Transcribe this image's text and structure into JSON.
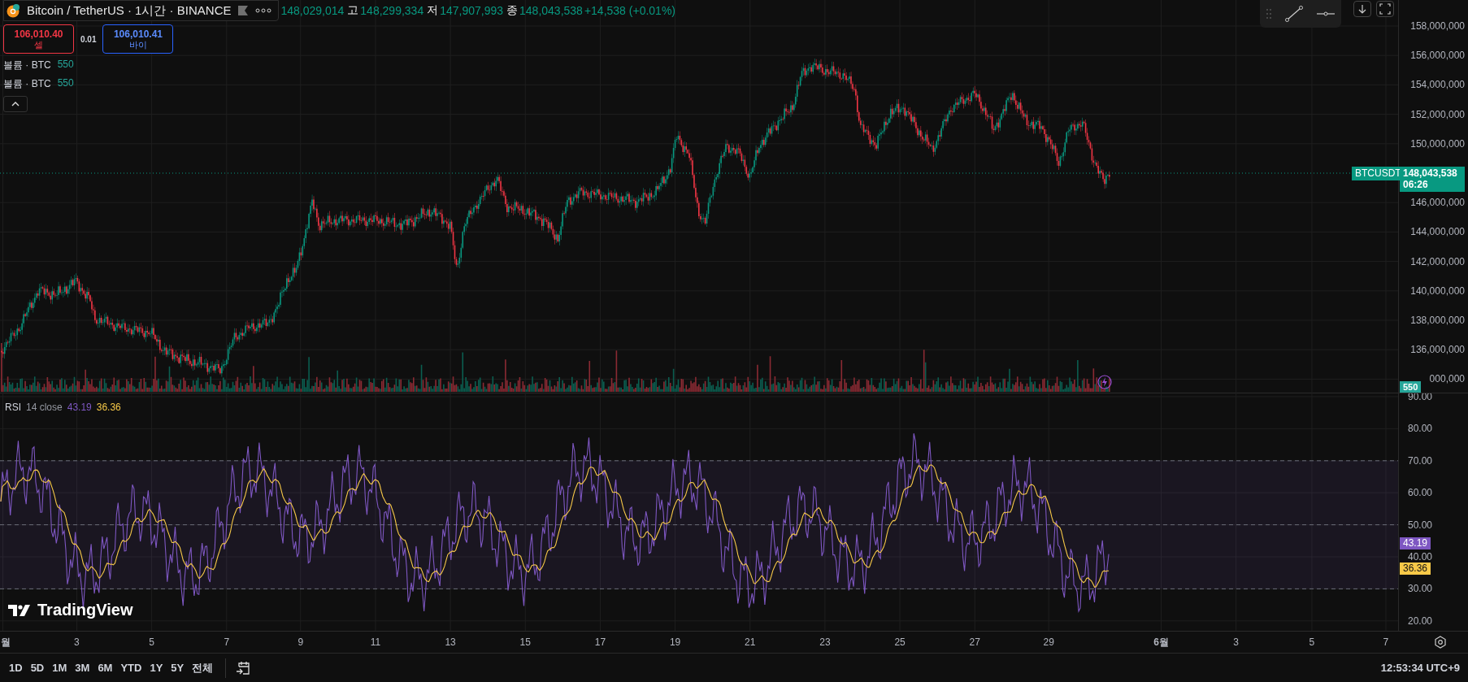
{
  "legend": {
    "symbol": "Bitcoin / TetherUS · 1시간 · BINANCE",
    "ohlc": [
      {
        "value": "148,029,014"
      },
      {
        "label": "고",
        "value": "148,299,334"
      },
      {
        "label": "저",
        "value": "147,907,993"
      },
      {
        "label": "종",
        "value": "148,043,538"
      }
    ],
    "change": "+14,538 (+0.01%)"
  },
  "trade": {
    "sell": {
      "price": "106,010.40",
      "label": "셀"
    },
    "spread": "0.01",
    "buy": {
      "price": "106,010.41",
      "label": "바이"
    }
  },
  "volume_legends": [
    {
      "label": "볼륨 · BTC",
      "value": "550"
    },
    {
      "label": "볼륨 · BTC",
      "value": "550"
    }
  ],
  "price_axis": {
    "ticks": [
      "158,000,000",
      "156,000,000",
      "154,000,000",
      "152,000,000",
      "150,000,000",
      "146,000,000",
      "144,000,000",
      "142,000,000",
      "140,000,000",
      "138,000,000",
      "136,000,000",
      "000,000"
    ],
    "symbol_tag": "BTCUSDT",
    "last_price": "148,043,538",
    "countdown": "06:26",
    "volume_tag": "550"
  },
  "rsi": {
    "name": "RSI",
    "params": "14 close",
    "value": "43.19",
    "ma_value": "36.36",
    "ticks": [
      "90.00",
      "80.00",
      "70.00",
      "60.00",
      "50.00",
      "40.00",
      "30.00",
      "20.00"
    ],
    "value_tag": "43.19",
    "ma_tag": "36.36"
  },
  "logo_text": "TradingView",
  "time_axis": [
    {
      "text": "월",
      "kind": "month"
    },
    {
      "text": "3",
      "kind": "day"
    },
    {
      "text": "5",
      "kind": "day"
    },
    {
      "text": "7",
      "kind": "day"
    },
    {
      "text": "9",
      "kind": "day"
    },
    {
      "text": "11",
      "kind": "day"
    },
    {
      "text": "13",
      "kind": "day"
    },
    {
      "text": "15",
      "kind": "day"
    },
    {
      "text": "17",
      "kind": "day"
    },
    {
      "text": "19",
      "kind": "day"
    },
    {
      "text": "21",
      "kind": "day"
    },
    {
      "text": "23",
      "kind": "day"
    },
    {
      "text": "25",
      "kind": "day"
    },
    {
      "text": "27",
      "kind": "day"
    },
    {
      "text": "29",
      "kind": "day"
    },
    {
      "text": "6월",
      "kind": "month"
    },
    {
      "text": "3",
      "kind": "day"
    },
    {
      "text": "5",
      "kind": "day"
    },
    {
      "text": "7",
      "kind": "day"
    }
  ],
  "ranges": [
    "1D",
    "5D",
    "1M",
    "3M",
    "6M",
    "YTD",
    "1Y",
    "5Y",
    "전체"
  ],
  "clock": "12:53:34 UTC+9"
}
